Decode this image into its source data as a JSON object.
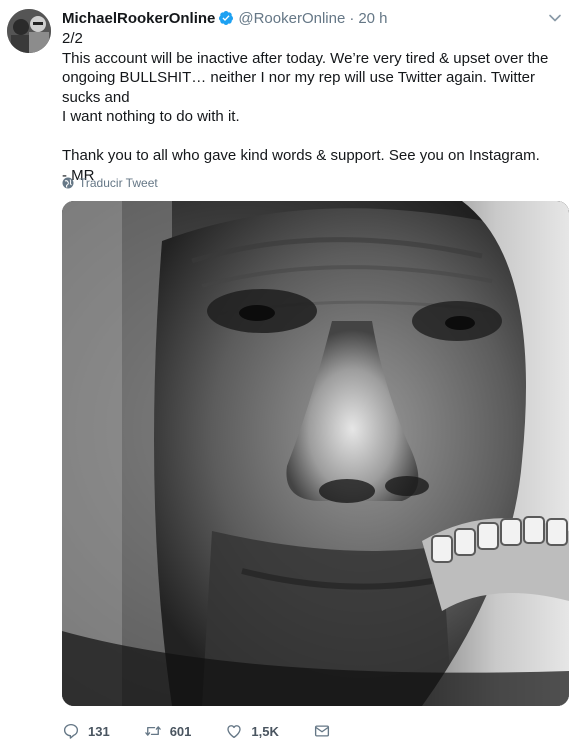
{
  "tweet": {
    "author_name": "MichaelRookerOnline",
    "handle": "@RookerOnline",
    "separator": "·",
    "time": "20 h",
    "lines": [
      "2/2",
      "This account will be inactive after today. We’re very tired & upset over the",
      "ongoing BULLSHIT… neither I nor my rep will use Twitter again.  Twitter sucks and",
      "I want nothing to do with it.",
      "",
      "Thank you to all who gave kind words & support. See you on Instagram.",
      "- MR"
    ],
    "translate_label": "Traducir Tweet"
  },
  "actions": {
    "replies": "131",
    "retweets": "601",
    "likes": "1,5K"
  },
  "icons": {
    "verified": "verified-badge-icon",
    "caret": "chevron-down-icon",
    "globe": "globe-icon",
    "reply": "reply-icon",
    "retweet": "retweet-icon",
    "like": "heart-icon",
    "message": "envelope-icon"
  },
  "colors": {
    "accent": "#1da1f2",
    "secondary_text": "#657786",
    "primary_text": "#14171a"
  }
}
